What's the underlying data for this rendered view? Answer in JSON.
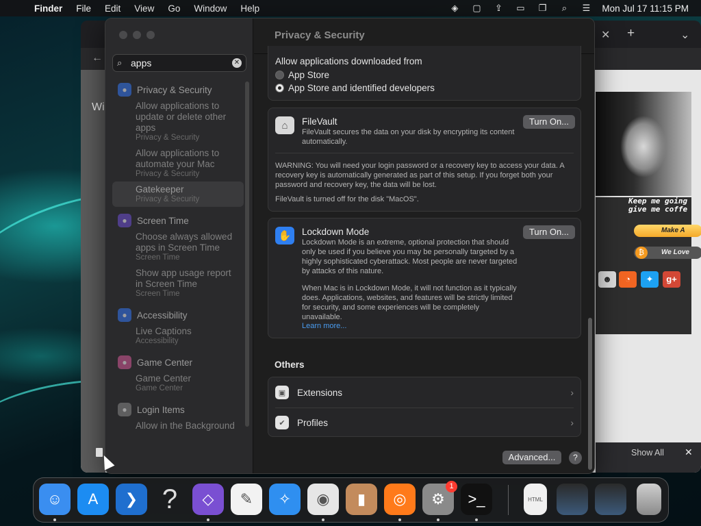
{
  "menubar": {
    "app": "Finder",
    "items": [
      "File",
      "Edit",
      "View",
      "Go",
      "Window",
      "Help"
    ],
    "clock": "Mon Jul 17  11:15 PM",
    "status_icons": [
      "maps-icon",
      "app-icon",
      "upload-icon",
      "tablet-icon",
      "screens-icon",
      "search-icon",
      "control-center-icon"
    ]
  },
  "browser": {
    "site_quote_line1": "Keep me going",
    "site_quote_line2": "give me coffe",
    "pill_yellow": "Make A",
    "pill_grey": "We Love",
    "partial_text": "Wi",
    "show_all": "Show All"
  },
  "settings": {
    "title": "Privacy & Security",
    "search": {
      "value": "apps"
    },
    "sidebar": [
      {
        "label": "Privacy & Security",
        "icon": "hand-icon",
        "color": "#3478f6",
        "items": [
          {
            "title": "Allow applications to update or delete other apps",
            "sub": "Privacy & Security"
          },
          {
            "title": "Allow applications to automate your Mac",
            "sub": "Privacy & Security"
          },
          {
            "title": "Gatekeeper",
            "sub": "Privacy & Security",
            "selected": true
          }
        ]
      },
      {
        "label": "Screen Time",
        "icon": "hourglass-icon",
        "color": "#6e4fd6",
        "items": [
          {
            "title": "Choose always allowed apps in Screen Time",
            "sub": "Screen Time"
          },
          {
            "title": "Show app usage report in Screen Time",
            "sub": "Screen Time"
          }
        ]
      },
      {
        "label": "Accessibility",
        "icon": "accessibility-icon",
        "color": "#3478f6",
        "items": [
          {
            "title": "Live Captions",
            "sub": "Accessibility"
          }
        ]
      },
      {
        "label": "Game Center",
        "icon": "game-center-icon",
        "color": "#d85a9a",
        "items": [
          {
            "title": "Game Center",
            "sub": "Game Center"
          }
        ]
      },
      {
        "label": "Login Items",
        "icon": "list-icon",
        "color": "#8a8a8a",
        "items": [
          {
            "title": "Allow in the Background",
            "sub": ""
          }
        ]
      }
    ],
    "allow": {
      "title": "Allow applications downloaded from",
      "options": [
        "App Store",
        "App Store and identified developers"
      ],
      "selected": "App Store and identified developers"
    },
    "filevault": {
      "title": "FileVault",
      "desc": "FileVault secures the data on your disk by encrypting its content automatically.",
      "button": "Turn On...",
      "warning": "WARNING: You will need your login password or a recovery key to access your data. A recovery key is automatically generated as part of this setup. If you forget both your password and recovery key, the data will be lost.",
      "status": "FileVault is turned off for the disk \"MacOS\"."
    },
    "lockdown": {
      "title": "Lockdown Mode",
      "desc": "Lockdown Mode is an extreme, optional protection that should only be used if you believe you may be personally targeted by a highly sophisticated cyberattack. Most people are never targeted by attacks of this nature.",
      "desc2": "When Mac is in Lockdown Mode, it will not function as it typically does. Applications, websites, and features will be strictly limited for security, and some experiences will be completely unavailable.",
      "learn_more": "Learn more...",
      "button": "Turn On..."
    },
    "others": {
      "title": "Others",
      "rows": [
        {
          "label": "Extensions",
          "icon": "extensions-icon"
        },
        {
          "label": "Profiles",
          "icon": "profiles-icon"
        }
      ]
    },
    "advanced": "Advanced...",
    "help": "?"
  },
  "dock": {
    "items": [
      {
        "name": "finder",
        "glyph": "☺",
        "color": "#3a8ef0"
      },
      {
        "name": "app-store",
        "glyph": "A",
        "color": "#1c8cf2"
      },
      {
        "name": "vscode",
        "glyph": "❯",
        "color": "#1f6fcf"
      },
      {
        "name": "help",
        "glyph": "?",
        "color": "transparent"
      },
      {
        "name": "visual-studio",
        "glyph": "◇",
        "color": "#7a4fd2"
      },
      {
        "name": "textedit",
        "glyph": "✎",
        "color": "#f2f2f2"
      },
      {
        "name": "safari",
        "glyph": "✧",
        "color": "#2f8ff0"
      },
      {
        "name": "chrome",
        "glyph": "◉",
        "color": "#e6e6e6"
      },
      {
        "name": "archive",
        "glyph": "▮",
        "color": "#c38b5c"
      },
      {
        "name": "firefox",
        "glyph": "◎",
        "color": "#ff7a1a"
      },
      {
        "name": "system-settings",
        "glyph": "⚙",
        "color": "#8a8a8a",
        "badge": "1"
      },
      {
        "name": "terminal",
        "glyph": ">_",
        "color": "#111"
      }
    ],
    "trailing": [
      {
        "name": "html-file",
        "label": "HTML"
      },
      {
        "name": "window-1",
        "label": ""
      },
      {
        "name": "window-2",
        "label": ""
      },
      {
        "name": "trash",
        "label": ""
      }
    ]
  }
}
